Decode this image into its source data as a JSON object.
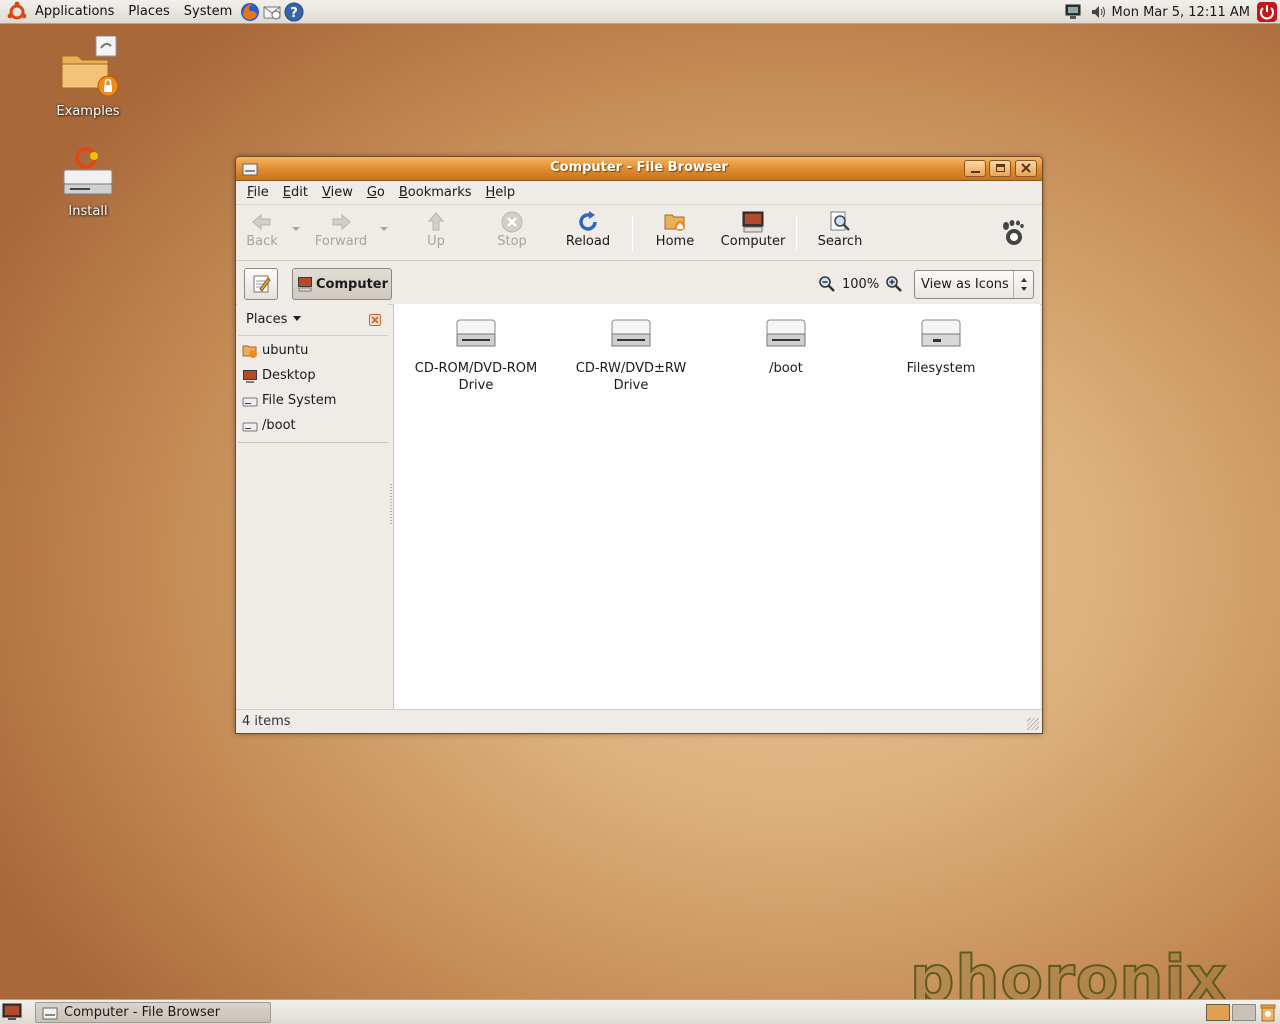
{
  "top_panel": {
    "menus": [
      "Applications",
      "Places",
      "System"
    ],
    "clock": "Mon Mar  5, 12:11 AM"
  },
  "desktop": {
    "icons": [
      {
        "label": "Examples",
        "icon": "folder-icon"
      },
      {
        "label": "Install",
        "icon": "drive-icon"
      }
    ]
  },
  "window": {
    "title": "Computer - File Browser",
    "menu": [
      {
        "key": "F",
        "rest": "ile"
      },
      {
        "key": "E",
        "rest": "dit"
      },
      {
        "key": "V",
        "rest": "iew"
      },
      {
        "key": "G",
        "rest": "o"
      },
      {
        "key": "B",
        "rest": "ookmarks"
      },
      {
        "key": "H",
        "rest": "elp"
      }
    ],
    "toolbar": {
      "back": "Back",
      "forward": "Forward",
      "up": "Up",
      "stop": "Stop",
      "reload": "Reload",
      "home": "Home",
      "computer": "Computer",
      "search": "Search"
    },
    "location": {
      "crumb": "Computer",
      "zoom": "100%",
      "view_mode": "View as Icons"
    },
    "sidebar": {
      "header": "Places",
      "items": [
        {
          "label": "ubuntu",
          "icon": "home-folder-icon"
        },
        {
          "label": "Desktop",
          "icon": "desktop-icon"
        },
        {
          "label": "File System",
          "icon": "filesystem-icon"
        },
        {
          "label": "/boot",
          "icon": "drive-icon"
        }
      ]
    },
    "files": [
      {
        "line1": "CD-ROM/DVD-ROM",
        "line2": "Drive"
      },
      {
        "line1": "CD-RW/DVD±RW",
        "line2": "Drive"
      },
      {
        "line1": "/boot",
        "line2": ""
      },
      {
        "line1": "Filesystem",
        "line2": ""
      }
    ],
    "status": "4 items"
  },
  "bottom_panel": {
    "task": "Computer - File Browser"
  },
  "watermark": "phoronix",
  "colors": {
    "titlebar": "#dd8a2f",
    "desktop": "#ddb07c"
  }
}
